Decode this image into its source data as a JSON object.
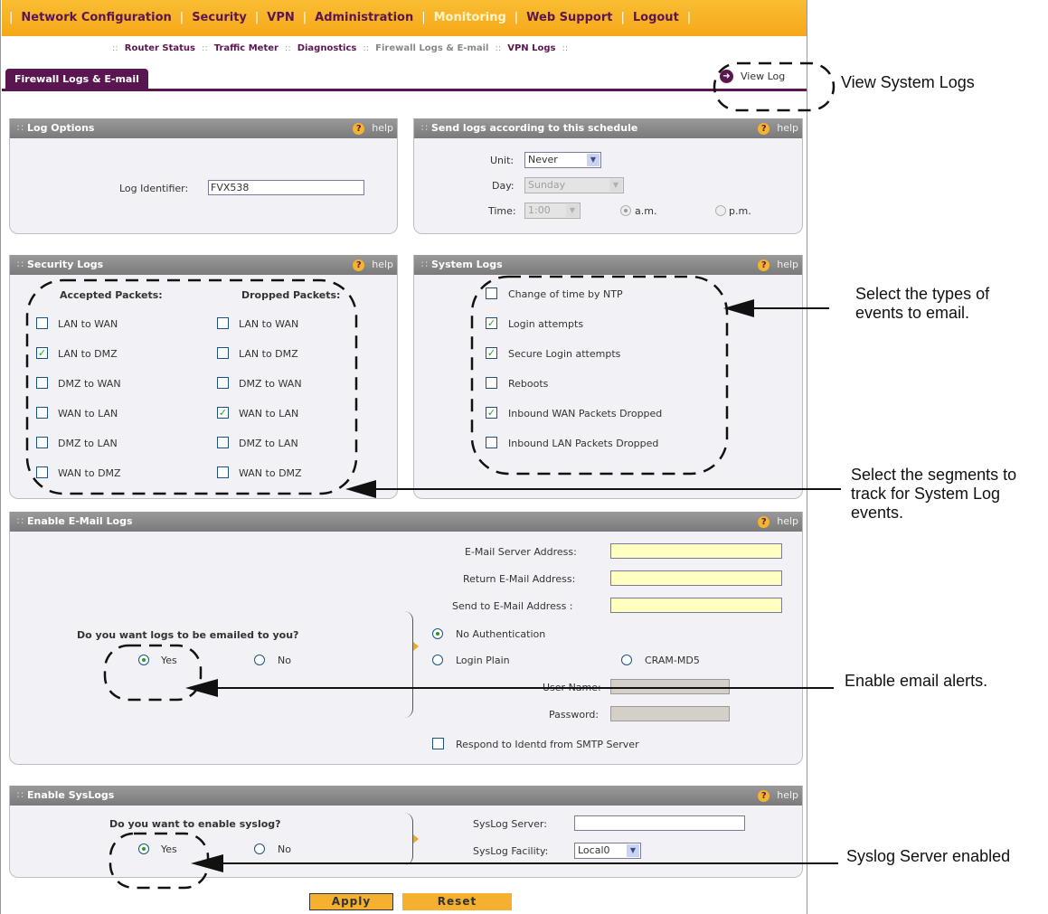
{
  "topnav": {
    "items": [
      {
        "label": "Network Configuration"
      },
      {
        "label": "Security"
      },
      {
        "label": "VPN"
      },
      {
        "label": "Administration"
      },
      {
        "label": "Monitoring"
      },
      {
        "label": "Web Support"
      },
      {
        "label": "Logout"
      }
    ],
    "separator": "|",
    "active": "Monitoring"
  },
  "subnav": {
    "separator": "::",
    "items": [
      "Router Status",
      "Traffic Meter",
      "Diagnostics",
      "Firewall Logs & E-mail",
      "VPN Logs"
    ],
    "active": "Firewall Logs & E-mail"
  },
  "tab": {
    "label": "Firewall Logs & E-mail",
    "view_log": "View Log"
  },
  "help_label": "help",
  "grip": "∷",
  "log_options": {
    "title": "Log Options",
    "identifier_label": "Log Identifier:",
    "identifier_value": "FVX538"
  },
  "schedule": {
    "title": "Send logs according to this schedule",
    "unit_label": "Unit:",
    "unit_value": "Never",
    "day_label": "Day:",
    "day_value": "Sunday",
    "time_label": "Time:",
    "time_value": "1:00",
    "am_label": "a.m.",
    "pm_label": "p.m."
  },
  "security_logs": {
    "title": "Security Logs",
    "accepted_header": "Accepted Packets:",
    "dropped_header": "Dropped Packets:",
    "accepted": [
      {
        "label": "LAN to WAN",
        "checked": false
      },
      {
        "label": "LAN to DMZ",
        "checked": true
      },
      {
        "label": "DMZ to WAN",
        "checked": false
      },
      {
        "label": "WAN to LAN",
        "checked": false
      },
      {
        "label": "DMZ to LAN",
        "checked": false
      },
      {
        "label": "WAN to DMZ",
        "checked": false
      }
    ],
    "dropped": [
      {
        "label": "LAN to WAN",
        "checked": false
      },
      {
        "label": "LAN to DMZ",
        "checked": false
      },
      {
        "label": "DMZ to WAN",
        "checked": false
      },
      {
        "label": "WAN to LAN",
        "checked": true
      },
      {
        "label": "DMZ to LAN",
        "checked": false
      },
      {
        "label": "WAN to DMZ",
        "checked": false
      }
    ]
  },
  "system_logs": {
    "title": "System Logs",
    "items": [
      {
        "label": "Change of time by NTP",
        "checked": false
      },
      {
        "label": "Login attempts",
        "checked": true
      },
      {
        "label": "Secure Login attempts",
        "checked": true
      },
      {
        "label": "Reboots",
        "checked": false
      },
      {
        "label": "Inbound WAN Packets Dropped",
        "checked": true
      },
      {
        "label": "Inbound LAN Packets Dropped",
        "checked": false
      }
    ]
  },
  "email_logs": {
    "title": "Enable E-Mail Logs",
    "server_label": "E-Mail Server Address:",
    "return_label": "Return E-Mail Address:",
    "send_label": "Send to E-Mail Address :",
    "question": "Do you want logs to be emailed to you?",
    "yes": "Yes",
    "no": "No",
    "no_auth": "No Authentication",
    "login_plain": "Login Plain",
    "cram": "CRAM-MD5",
    "user_label": "User Name:",
    "password_label": "Password:",
    "identd_label": "Respond to Identd from SMTP Server"
  },
  "syslog": {
    "title": "Enable SysLogs",
    "question": "Do you want to enable syslog?",
    "yes": "Yes",
    "no": "No",
    "server_label": "SysLog Server:",
    "facility_label": "SysLog Facility:",
    "facility_value": "Local0"
  },
  "buttons": {
    "apply": "Apply",
    "reset": "Reset"
  },
  "callouts": {
    "view_system_logs": "View System Logs",
    "select_types": "Select the types of events to email.",
    "select_segments": "Select the segments to track for System Log events.",
    "enable_email": "Enable email alerts.",
    "syslog_enabled": "Syslog Server enabled"
  }
}
